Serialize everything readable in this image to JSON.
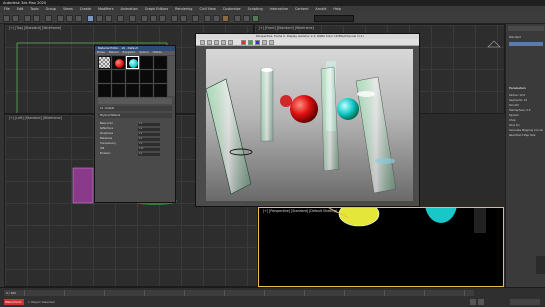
{
  "app": {
    "title": "Autodesk 3ds Max 2020"
  },
  "menu": [
    "File",
    "Edit",
    "Tools",
    "Group",
    "Views",
    "Create",
    "Modifiers",
    "Animation",
    "Graph Editors",
    "Rendering",
    "Civil View",
    "Customize",
    "Scripting",
    "Interactive",
    "Content",
    "Arnold",
    "Help"
  ],
  "toolbar": {
    "search_placeholder": "Type a keyword"
  },
  "viewports": {
    "top": "[+] [Top] [Standard] [Wireframe]",
    "front": "[+] [Front] [Standard] [Wireframe]",
    "left": "[+] [Left] [Standard] [Wireframe]",
    "perspective": "[+] [Perspective] [Standard] [Default Shading]"
  },
  "material_editor": {
    "title": "Material Editor - 10 - Default",
    "menu": [
      "Modes",
      "Material",
      "Navigation",
      "Options",
      "Utilities"
    ],
    "material_name": "10 - Default",
    "material_type": "Physical Material",
    "params": [
      {
        "label": "Base Color",
        "value": "1.0"
      },
      {
        "label": "Reflections",
        "value": "1.0"
      },
      {
        "label": "Roughness",
        "value": "0.0"
      },
      {
        "label": "Metalness",
        "value": "0.0"
      },
      {
        "label": "Transparency",
        "value": "1.0"
      },
      {
        "label": "IOR",
        "value": "1.52"
      },
      {
        "label": "Emission",
        "value": "0.0"
      }
    ]
  },
  "render_window": {
    "title": "Perspective, frame 0, Display Gamma: 2.2, RGBA Color 16 Bits/Channel (1:1)"
  },
  "right_panel": {
    "tab": "Standard",
    "section": "Parameters",
    "lines": [
      "Radius: 10.0",
      "Segments: 32",
      "Smooth",
      "Hemisphere: 0.0",
      "Squash",
      "Chop",
      "Slice On",
      "Generate Mapping Coords",
      "Real-World Map Size"
    ]
  },
  "status": {
    "welcome": "Welcome to M",
    "text": "1 Object Selected",
    "frame": "0 / 100"
  },
  "colors": {
    "accent": "#2c4b7a",
    "background": "#2b2b2b",
    "selection": "#e3c24a"
  }
}
